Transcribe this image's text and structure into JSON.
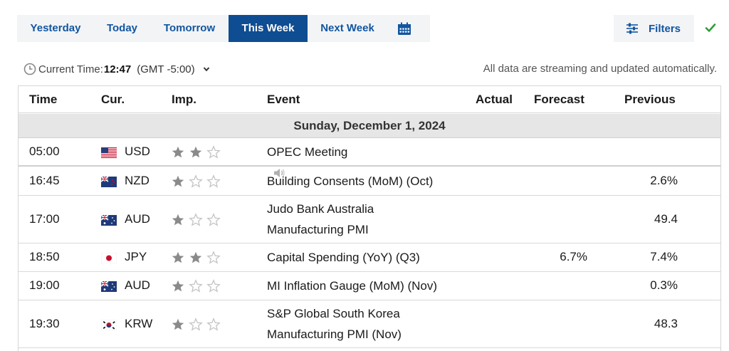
{
  "tabs": [
    {
      "label": "Yesterday",
      "active": false
    },
    {
      "label": "Today",
      "active": false
    },
    {
      "label": "Tomorrow",
      "active": false
    },
    {
      "label": "This Week",
      "active": true
    },
    {
      "label": "Next Week",
      "active": false
    }
  ],
  "calendar_icon": "calendar-icon",
  "filters_label": "Filters",
  "status_icon": "check-icon",
  "current_time": {
    "label": "Current Time:",
    "value": "12:47",
    "timezone": "(GMT -5:00)"
  },
  "streaming_notice": "All data are streaming and updated automatically.",
  "table": {
    "headers": {
      "time": "Time",
      "currency": "Cur.",
      "importance": "Imp.",
      "event": "Event",
      "actual": "Actual",
      "forecast": "Forecast",
      "previous": "Previous"
    },
    "day_label": "Sunday, December 1, 2024",
    "rows": [
      {
        "time": "05:00",
        "flag": "us",
        "currency": "USD",
        "importance": 2,
        "event_lines": [
          "OPEC Meeting"
        ],
        "has_speaker": true,
        "actual": "",
        "forecast": "",
        "previous": ""
      },
      {
        "time": "16:45",
        "flag": "nz",
        "currency": "NZD",
        "importance": 1,
        "event_lines": [
          "Building Consents (MoM) (Oct)"
        ],
        "has_speaker": false,
        "actual": "",
        "forecast": "",
        "previous": "2.6%"
      },
      {
        "time": "17:00",
        "flag": "au",
        "currency": "AUD",
        "importance": 1,
        "event_lines": [
          "Judo Bank Australia",
          "Manufacturing PMI"
        ],
        "has_speaker": false,
        "actual": "",
        "forecast": "",
        "previous": "49.4"
      },
      {
        "time": "18:50",
        "flag": "jp",
        "currency": "JPY",
        "importance": 2,
        "event_lines": [
          "Capital Spending (YoY) (Q3)"
        ],
        "has_speaker": false,
        "actual": "",
        "forecast": "6.7%",
        "previous": "7.4%"
      },
      {
        "time": "19:00",
        "flag": "au",
        "currency": "AUD",
        "importance": 1,
        "event_lines": [
          "MI Inflation Gauge (MoM) (Nov)"
        ],
        "has_speaker": false,
        "actual": "",
        "forecast": "",
        "previous": "0.3%"
      },
      {
        "time": "19:30",
        "flag": "kr",
        "currency": "KRW",
        "importance": 1,
        "event_lines": [
          "S&P Global South Korea",
          "Manufacturing PMI (Nov)"
        ],
        "has_speaker": false,
        "actual": "",
        "forecast": "",
        "previous": "48.3"
      }
    ]
  },
  "colors": {
    "accent": "#1256a0",
    "active_tab": "#0f4d93",
    "star_filled": "#8a8a8a",
    "star_empty": "#c4c4c4",
    "check": "#2e9e3a"
  }
}
